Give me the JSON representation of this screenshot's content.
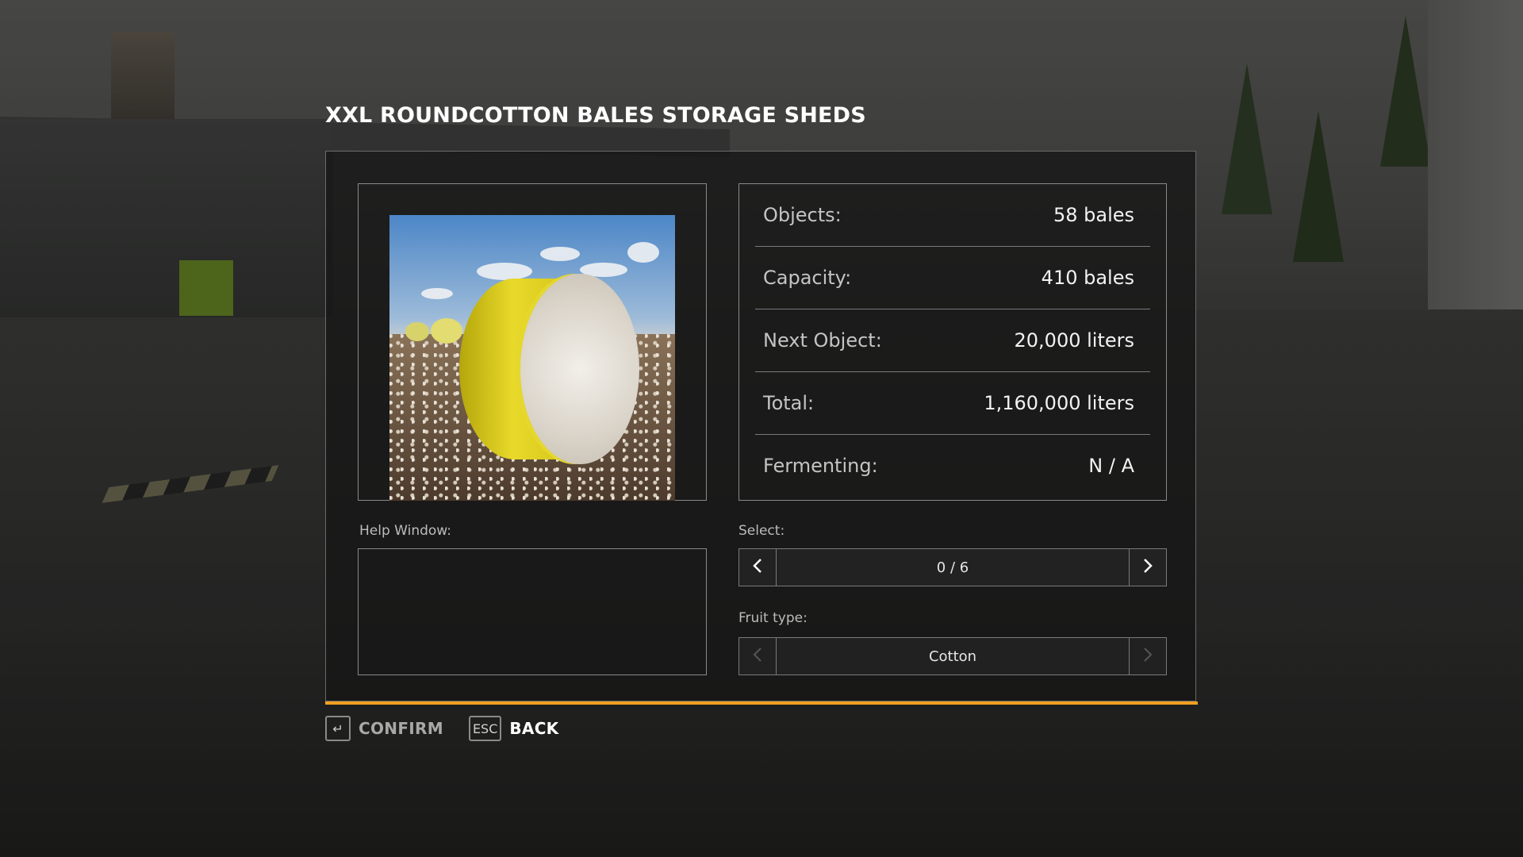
{
  "dialog": {
    "title": "XXL ROUNDCOTTON BALES STORAGE SHEDS"
  },
  "stats": [
    {
      "label": "Objects:",
      "value": "58 bales"
    },
    {
      "label": "Capacity:",
      "value": "410 bales"
    },
    {
      "label": "Next Object:",
      "value": "20,000 liters"
    },
    {
      "label": "Total:",
      "value": "1,160,000 liters"
    },
    {
      "label": "Fermenting:",
      "value": "N / A"
    }
  ],
  "help": {
    "label": "Help Window:"
  },
  "select": {
    "label": "Select:",
    "value": "0 / 6",
    "prev_icon": "chevron-left-icon",
    "next_icon": "chevron-right-icon"
  },
  "fruit_type": {
    "label": "Fruit type:",
    "value": "Cotton"
  },
  "footer": {
    "confirm_key": "↵",
    "confirm_label": "CONFIRM",
    "back_key": "ESC",
    "back_label": "BACK"
  },
  "colors": {
    "accent": "#f0a020",
    "panel_bg": "#161616"
  }
}
